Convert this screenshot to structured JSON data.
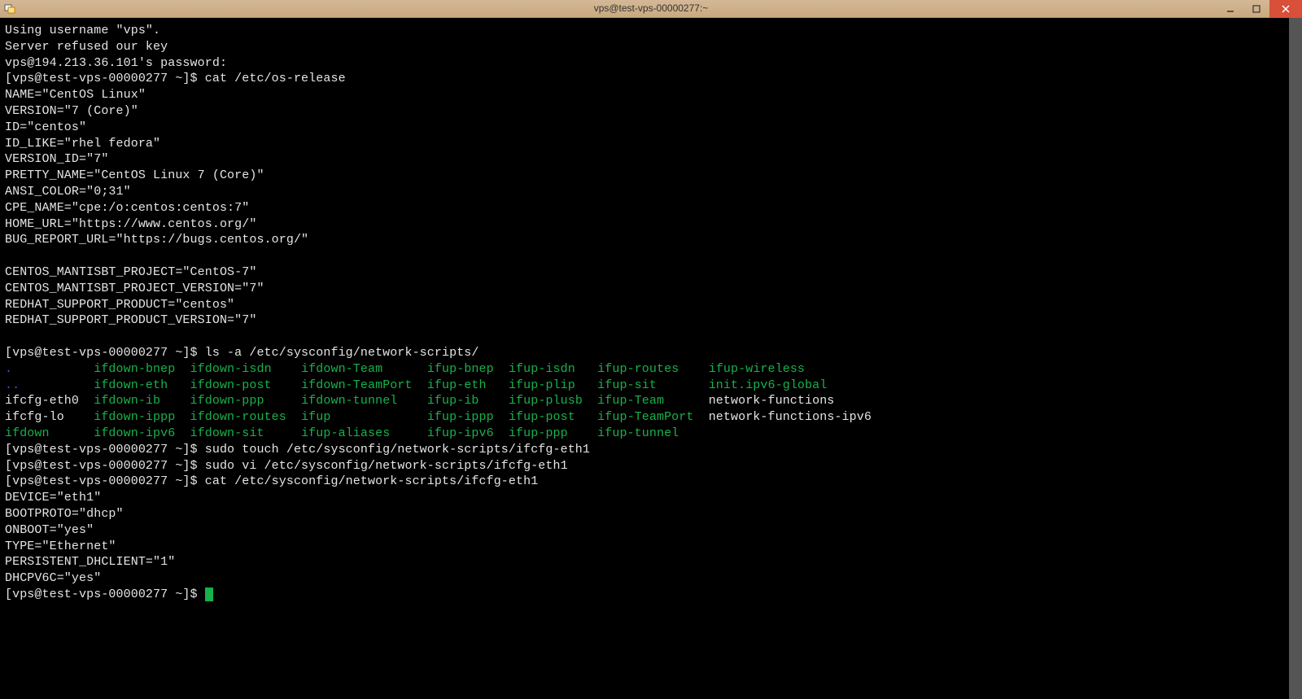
{
  "window": {
    "title": "vps@test-vps-00000277:~"
  },
  "session": {
    "login_line1": "Using username \"vps\".",
    "login_line2": "Server refused our key",
    "login_line3": "vps@194.213.36.101's password:"
  },
  "prompt": "[vps@test-vps-00000277 ~]$ ",
  "commands": {
    "cmd1": "cat /etc/os-release",
    "cmd2": "ls -a /etc/sysconfig/network-scripts/",
    "cmd3": "sudo touch /etc/sysconfig/network-scripts/ifcfg-eth1",
    "cmd4": "sudo vi /etc/sysconfig/network-scripts/ifcfg-eth1",
    "cmd5": "cat /etc/sysconfig/network-scripts/ifcfg-eth1"
  },
  "os_release": [
    "NAME=\"CentOS Linux\"",
    "VERSION=\"7 (Core)\"",
    "ID=\"centos\"",
    "ID_LIKE=\"rhel fedora\"",
    "VERSION_ID=\"7\"",
    "PRETTY_NAME=\"CentOS Linux 7 (Core)\"",
    "ANSI_COLOR=\"0;31\"",
    "CPE_NAME=\"cpe:/o:centos:centos:7\"",
    "HOME_URL=\"https://www.centos.org/\"",
    "BUG_REPORT_URL=\"https://bugs.centos.org/\"",
    "",
    "CENTOS_MANTISBT_PROJECT=\"CentOS-7\"",
    "CENTOS_MANTISBT_PROJECT_VERSION=\"7\"",
    "REDHAT_SUPPORT_PRODUCT=\"centos\"",
    "REDHAT_SUPPORT_PRODUCT_VERSION=\"7\""
  ],
  "ls_listing": [
    [
      {
        "t": ".",
        "c": "blue",
        "w": 12
      },
      {
        "t": "ifdown-bnep",
        "c": "green",
        "w": 13
      },
      {
        "t": "ifdown-isdn",
        "c": "green",
        "w": 15
      },
      {
        "t": "ifdown-Team",
        "c": "green",
        "w": 17
      },
      {
        "t": "ifup-bnep",
        "c": "green",
        "w": 11
      },
      {
        "t": "ifup-isdn",
        "c": "green",
        "w": 12
      },
      {
        "t": "ifup-routes",
        "c": "green",
        "w": 15
      },
      {
        "t": "ifup-wireless",
        "c": "green",
        "w": 0
      }
    ],
    [
      {
        "t": "..",
        "c": "blue",
        "w": 12
      },
      {
        "t": "ifdown-eth",
        "c": "green",
        "w": 13
      },
      {
        "t": "ifdown-post",
        "c": "green",
        "w": 15
      },
      {
        "t": "ifdown-TeamPort",
        "c": "green",
        "w": 17
      },
      {
        "t": "ifup-eth",
        "c": "green",
        "w": 11
      },
      {
        "t": "ifup-plip",
        "c": "green",
        "w": 12
      },
      {
        "t": "ifup-sit",
        "c": "green",
        "w": 15
      },
      {
        "t": "init.ipv6-global",
        "c": "green",
        "w": 0
      }
    ],
    [
      {
        "t": "ifcfg-eth0",
        "c": "white",
        "w": 12
      },
      {
        "t": "ifdown-ib",
        "c": "green",
        "w": 13
      },
      {
        "t": "ifdown-ppp",
        "c": "green",
        "w": 15
      },
      {
        "t": "ifdown-tunnel",
        "c": "green",
        "w": 17
      },
      {
        "t": "ifup-ib",
        "c": "green",
        "w": 11
      },
      {
        "t": "ifup-plusb",
        "c": "green",
        "w": 12
      },
      {
        "t": "ifup-Team",
        "c": "green",
        "w": 15
      },
      {
        "t": "network-functions",
        "c": "white",
        "w": 0
      }
    ],
    [
      {
        "t": "ifcfg-lo",
        "c": "white",
        "w": 12
      },
      {
        "t": "ifdown-ippp",
        "c": "green",
        "w": 13
      },
      {
        "t": "ifdown-routes",
        "c": "green",
        "w": 15
      },
      {
        "t": "ifup",
        "c": "green",
        "w": 17
      },
      {
        "t": "ifup-ippp",
        "c": "green",
        "w": 11
      },
      {
        "t": "ifup-post",
        "c": "green",
        "w": 12
      },
      {
        "t": "ifup-TeamPort",
        "c": "green",
        "w": 15
      },
      {
        "t": "network-functions-ipv6",
        "c": "white",
        "w": 0
      }
    ],
    [
      {
        "t": "ifdown",
        "c": "green",
        "w": 12
      },
      {
        "t": "ifdown-ipv6",
        "c": "green",
        "w": 13
      },
      {
        "t": "ifdown-sit",
        "c": "green",
        "w": 15
      },
      {
        "t": "ifup-aliases",
        "c": "green",
        "w": 17
      },
      {
        "t": "ifup-ipv6",
        "c": "green",
        "w": 11
      },
      {
        "t": "ifup-ppp",
        "c": "green",
        "w": 12
      },
      {
        "t": "ifup-tunnel",
        "c": "green",
        "w": 15
      }
    ]
  ],
  "ifcfg_eth1": [
    "DEVICE=\"eth1\"",
    "BOOTPROTO=\"dhcp\"",
    "ONBOOT=\"yes\"",
    "TYPE=\"Ethernet\"",
    "PERSISTENT_DHCLIENT=\"1\"",
    "DHCPV6C=\"yes\""
  ]
}
